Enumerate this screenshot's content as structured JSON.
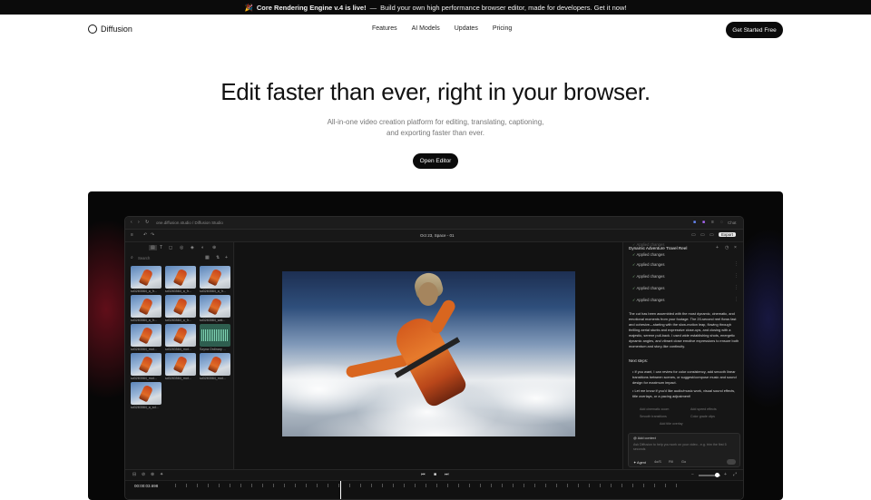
{
  "banner": {
    "emoji": "🎉",
    "headline": "Core Rendering Engine v.4 is live!",
    "separator": "—",
    "text": "Build your own high performance browser editor, made for developers. Get it now!"
  },
  "nav": {
    "logo": "Diffusion",
    "links": [
      "Features",
      "AI Models",
      "Updates",
      "Pricing"
    ],
    "cta": "Get Started Free"
  },
  "hero": {
    "title": "Edit faster than ever, right in your browser.",
    "subtitle": "All-in-one video creation platform for editing, translating, captioning, and exporting faster than ever.",
    "button": "Open Editor"
  },
  "app": {
    "url": "one.diffusion.studio / Diffusion Studio",
    "project_title": "Oct 23, Space - 01",
    "export_label": "Export",
    "chat_label": "Chat",
    "search_placeholder": "Search",
    "media": [
      {
        "label": "sd3283584_a_fr..."
      },
      {
        "label": "sd3283584_a_fr..."
      },
      {
        "label": "sd3283584_a_fr..."
      },
      {
        "label": "sd3283584_a_fr..."
      },
      {
        "label": "sd3283584_a_fr..."
      },
      {
        "label": "sd3283584_wat..."
      },
      {
        "label": "sd3283584_mot..."
      },
      {
        "label": "sd3283584_mot..."
      },
      {
        "label": "Szyna Ordinary ..."
      },
      {
        "label": "sd3283584_mot..."
      },
      {
        "label": "sd3283584_mot..."
      },
      {
        "label": "sd3283584_mot..."
      },
      {
        "label": "sd3283584_a_sd..."
      }
    ],
    "timecode": "00:00:03.698",
    "chat": {
      "title": "Dynamic Adventure Travel Reel",
      "statuses": [
        "Applied changes",
        "Applied changes",
        "Applied changes",
        "Applied changes",
        "Applied changes",
        "Applied changes"
      ],
      "body": "The cut has been assembled with the most dynamic, cinematic, and emotional moments from your footage. The 20-second reel flows fast and cohesive—starting with the slow-motion leap, flowing through thrilling aerial stunts and expressive close-ups, and closing with a majestic, serene pull-back. I used wide establishing shots, energetic dynamic angles, and vibrant close emotive expressions to ensure both momentum and story-like continuity.",
      "next_steps_title": "Next steps:",
      "next_steps": [
        "If you want, I can review for color consistency, add smooth linear transitions between scenes, or suggest/compose music and sound design for maximum impact.",
        "Let me know if you'd like audio/music work, visual sound effects, title overlays, or a pacing adjustment!"
      ],
      "suggestions": [
        "Add cinematic zoom",
        "Add speed effects",
        "Smooth transitions",
        "Color grade clips",
        "Add title overlay"
      ],
      "context_label": "Add context",
      "input_placeholder": "Ask Diffusion to help you work on your video - e.g. trim the first 5 seconds",
      "mode_agent": "Agent",
      "mode_opt1": "4o/S",
      "mode_opt2": "Fill",
      "mode_opt3": "Go"
    }
  }
}
